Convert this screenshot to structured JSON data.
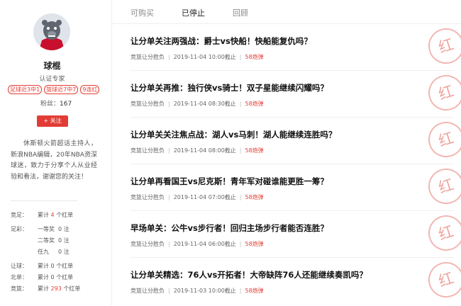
{
  "profile": {
    "name": "球棍",
    "role": "认证专家",
    "badges": [
      "足球近3中1",
      "篮球近7中7",
      "9连红"
    ],
    "fans_label": "粉丝：",
    "fans_count": "167",
    "follow_label": "+ 关注",
    "bio": "休斯顿火箭超话主持人，新浪NBA编辑，20年NBA资深球迷，致力于分享个人从业经验和看法，谢谢您的关注！"
  },
  "stats": [
    {
      "label": "竞足：",
      "sub": "",
      "pre": "累计",
      "num": "4",
      "post": "个红单",
      "highlight": true
    },
    {
      "label": "足彩：",
      "sub": "一等奖",
      "pre": "",
      "num": "0",
      "post": "注",
      "highlight": false
    },
    {
      "label": "",
      "sub": "二等奖",
      "pre": "",
      "num": "0",
      "post": "注",
      "highlight": false
    },
    {
      "label": "",
      "sub": "任九",
      "pre": "",
      "num": "0",
      "post": "注",
      "highlight": false
    },
    {
      "label": "让球：",
      "sub": "",
      "pre": "累计",
      "num": "0",
      "post": "个红单",
      "highlight": false
    },
    {
      "label": "北单：",
      "sub": "",
      "pre": "累计",
      "num": "0",
      "post": "个红单",
      "highlight": false
    },
    {
      "label": "竞篮：",
      "sub": "",
      "pre": "累计",
      "num": "293",
      "post": "个红单",
      "highlight": true
    }
  ],
  "tabs": [
    "可购买",
    "已停止",
    "回顾"
  ],
  "active_tab": "已停止",
  "articles": [
    {
      "title": "让分单关注两强战：爵士vs快船！快船能复仇吗？",
      "category": "竞篮让分胜负",
      "time": "2019-11-04 10:00截止",
      "count": "58炮弹",
      "stamp": "红"
    },
    {
      "title": "让分单关再推：独行侠vs骑士！双子星能继续闪耀吗？",
      "category": "竞篮让分胜负",
      "time": "2019-11-04 08:30截止",
      "count": "58炮弹",
      "stamp": "红"
    },
    {
      "title": "让分单关关注焦点战：湖人vs马刺！湖人能继续连胜吗？",
      "category": "竞篮让分胜负",
      "time": "2019-11-04 08:00截止",
      "count": "58炮弹",
      "stamp": "红"
    },
    {
      "title": "让分单再看国王vs尼克斯！青年军对碰谁能更胜一筹？",
      "category": "竞篮让分胜负",
      "time": "2019-11-04 07:00截止",
      "count": "58炮弹",
      "stamp": "红"
    },
    {
      "title": "早场单关：公牛vs步行者！回归主场步行者能否连胜？",
      "category": "竞篮让分胜负",
      "time": "2019-11-04 06:00截止",
      "count": "58炮弹",
      "stamp": "红"
    },
    {
      "title": "让分单关精选：76人vs开拓者！大帝缺阵76人还能继续奏凯吗？",
      "category": "竞篮让分胜负",
      "time": "2019-11-03 10:00截止",
      "count": "58炮弹",
      "stamp": "红"
    }
  ]
}
